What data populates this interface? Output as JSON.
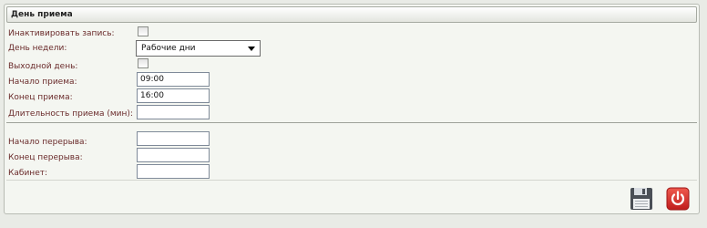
{
  "panel": {
    "title": "День приема"
  },
  "form": {
    "deactivate_label": "Инактивировать запись:",
    "weekday_label": "День недели:",
    "weekday_value": "Рабочие дни",
    "day_off_label": "Выходной день:",
    "start_label": "Начало приема:",
    "start_value": "09:00",
    "end_label": "Конец приема:",
    "end_value": "16:00",
    "duration_label": "Длительность приема (мин):",
    "duration_value": "",
    "break_start_label": "Начало перерыва:",
    "break_start_value": "",
    "break_end_label": "Конец перерыва:",
    "break_end_value": "",
    "cabinet_label": "Кабинет:",
    "cabinet_value": ""
  },
  "icons": {
    "save": "floppy-disk-icon",
    "close": "power-icon"
  },
  "colors": {
    "label": "#6a2b2b",
    "power_button": "#d42a2a"
  }
}
